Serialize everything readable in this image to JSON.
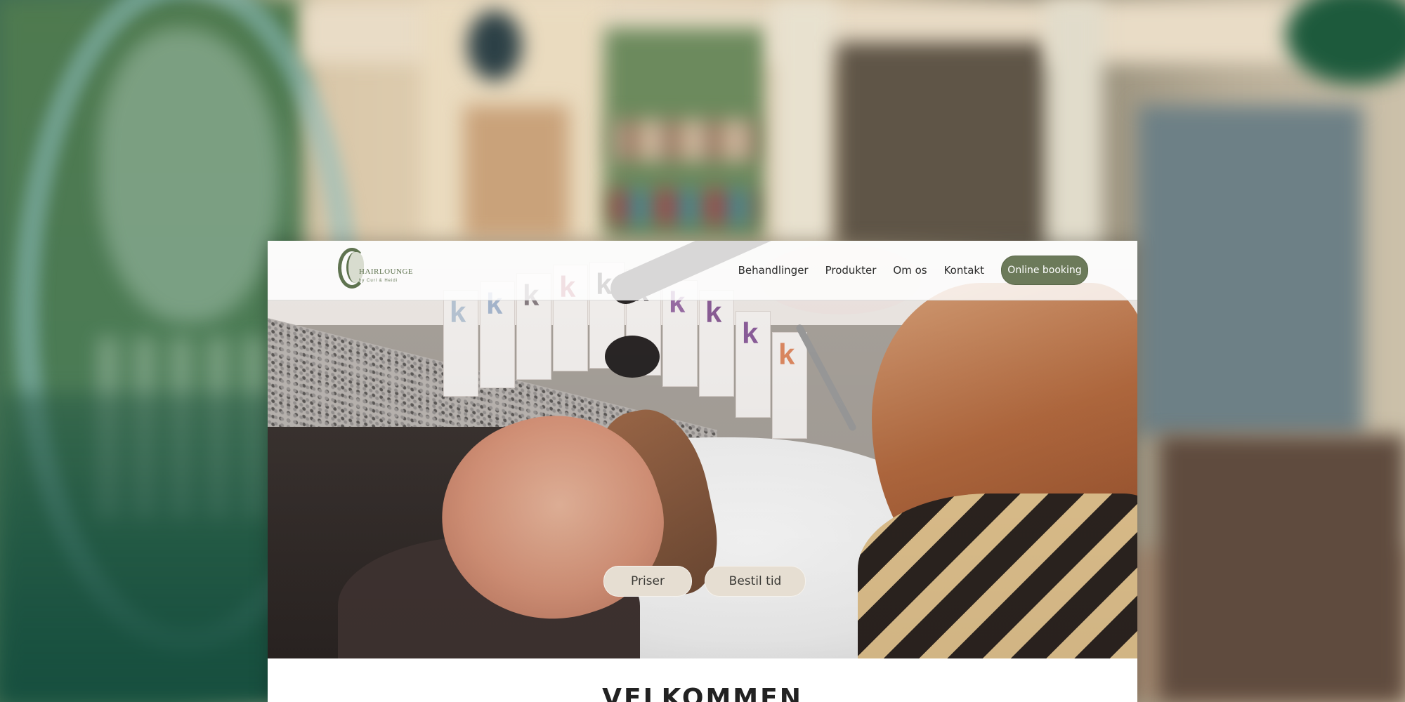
{
  "header": {
    "logo": {
      "name": "HAIRLOUNGE",
      "tagline": "by Curl & Heidi"
    },
    "nav": [
      {
        "label": "Behandlinger"
      },
      {
        "label": "Produkter"
      },
      {
        "label": "Om os"
      },
      {
        "label": "Kontakt"
      }
    ],
    "booking_label": "Online booking"
  },
  "hero": {
    "buttons": [
      {
        "label": "Priser"
      },
      {
        "label": "Bestil tid"
      }
    ]
  },
  "welcome": {
    "title": "VELKOMMEN"
  },
  "colors": {
    "accent": "#6c7a5a",
    "button_bg": "#e6ded2"
  }
}
